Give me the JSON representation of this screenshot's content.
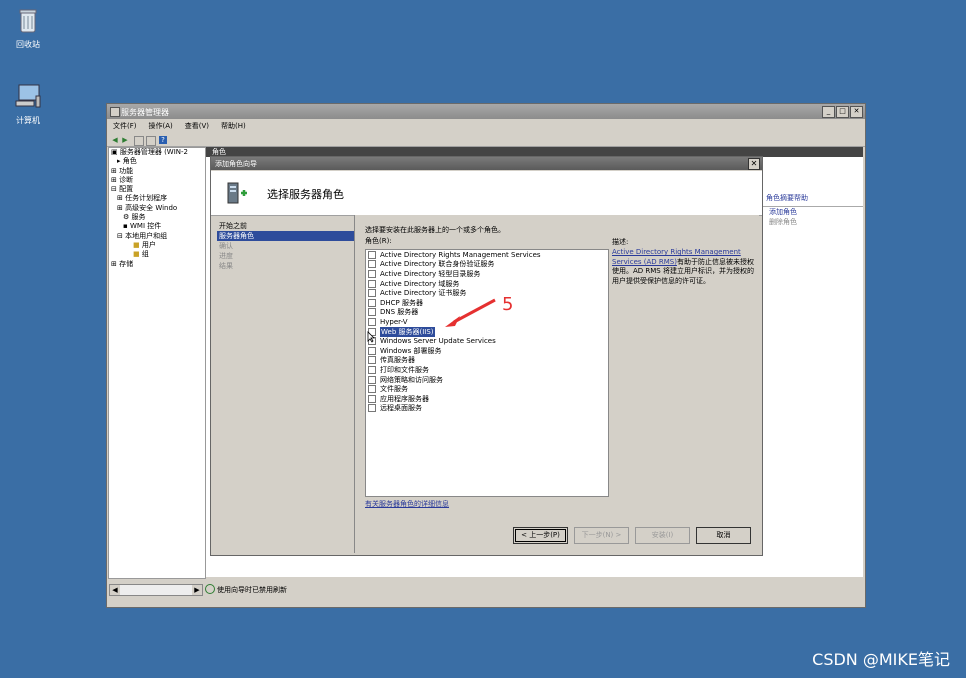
{
  "desktop": {
    "icons": [
      {
        "label": "回收站",
        "icon": "recycle-bin-icon"
      },
      {
        "label": "计算机",
        "icon": "computer-icon"
      }
    ]
  },
  "server_manager": {
    "title": "服务器管理器",
    "menu": [
      "文件(F)",
      "操作(A)",
      "查看(V)",
      "帮助(H)"
    ],
    "tree": [
      "服务器管理器 (WIN-2",
      "角色",
      "功能",
      "诊断",
      "配置",
      "任务计划程序",
      "高级安全 Windo",
      "服务",
      "WMI 控件",
      "本地用户和组",
      "用户",
      "组",
      "存储"
    ],
    "pane_header": "角色",
    "actions": {
      "title": "角色摘要帮助",
      "add_role": "添加角色",
      "remove_role": "删除角色"
    },
    "status": "使用向导时已禁用刷新"
  },
  "wizard": {
    "title": "添加角色向导",
    "heading": "选择服务器角色",
    "steps": [
      {
        "label": "开始之前",
        "state": "done"
      },
      {
        "label": "服务器角色",
        "state": "current"
      },
      {
        "label": "确认",
        "state": "todo"
      },
      {
        "label": "进度",
        "state": "todo"
      },
      {
        "label": "结果",
        "state": "todo"
      }
    ],
    "intro": "选择要安装在此服务器上的一个或多个角色。",
    "roles_label": "角色(R):",
    "roles": [
      "Active Directory Rights Management Services",
      "Active Directory 联合身份验证服务",
      "Active Directory 轻型目录服务",
      "Active Directory 域服务",
      "Active Directory 证书服务",
      "DHCP 服务器",
      "DNS 服务器",
      "Hyper-V",
      "Web 服务器(IIS)",
      "Windows Server Update Services",
      "Windows 部署服务",
      "传真服务器",
      "打印和文件服务",
      "网络策略和访问服务",
      "文件服务",
      "应用程序服务器",
      "远程桌面服务"
    ],
    "selected_role_index": 8,
    "description_label": "描述:",
    "description_link": "Active Directory Rights Management Services (AD RMS)",
    "description_text": "有助于防止信息被未授权使用。AD RMS 将建立用户标识，并为授权的用户提供受保护信息的许可证。",
    "more_info_link": "有关服务器角色的详细信息",
    "buttons": {
      "back": "< 上一步(P)",
      "next": "下一步(N) >",
      "install": "安装(I)",
      "cancel": "取消"
    }
  },
  "annotation": {
    "number": "5",
    "color": "#e53030"
  },
  "watermark": "CSDN @MIKE笔记"
}
